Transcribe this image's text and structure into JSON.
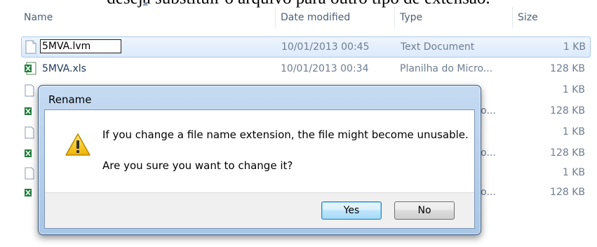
{
  "caption": "deseja substituir o arquivo para outro tipo de extensão.",
  "columns": {
    "name": "Name",
    "date_modified": "Date modified",
    "type": "Type",
    "size": "Size"
  },
  "files": [
    {
      "name": "5MVA.lvm",
      "date": "10/01/2013 00:45",
      "type": "Text Document",
      "size": "1 KB",
      "icon": "text-file-icon",
      "editing": true
    },
    {
      "name": "5MVA.xls",
      "date": "10/01/2013 00:34",
      "type": "Planilha do Micro...",
      "size": "128 KB",
      "icon": "excel-file-icon",
      "editing": false
    }
  ],
  "background_rows": [
    {
      "icon": "text-file-icon",
      "type": "",
      "size": "1 KB"
    },
    {
      "icon": "excel-file-icon",
      "type": "cro...",
      "size": "128 KB"
    },
    {
      "icon": "text-file-icon",
      "type": "",
      "size": "1 KB"
    },
    {
      "icon": "excel-file-icon",
      "type": "cro...",
      "size": "128 KB"
    },
    {
      "icon": "text-file-icon",
      "type": "",
      "size": "1 KB"
    },
    {
      "icon": "excel-file-icon",
      "type": "cro...",
      "size": "128 KB"
    }
  ],
  "dialog": {
    "title": "Rename",
    "message": "If you change a file name extension, the file might become unusable.",
    "question": "Are you sure you want to change it?",
    "yes_label": "Yes",
    "no_label": "No",
    "icon": "warning-icon"
  },
  "colors": {
    "selection": "#dbeafb",
    "dialog_frame": "#a9c6e6",
    "warning": "#f5c400",
    "excel_green": "#1f7a3a"
  }
}
